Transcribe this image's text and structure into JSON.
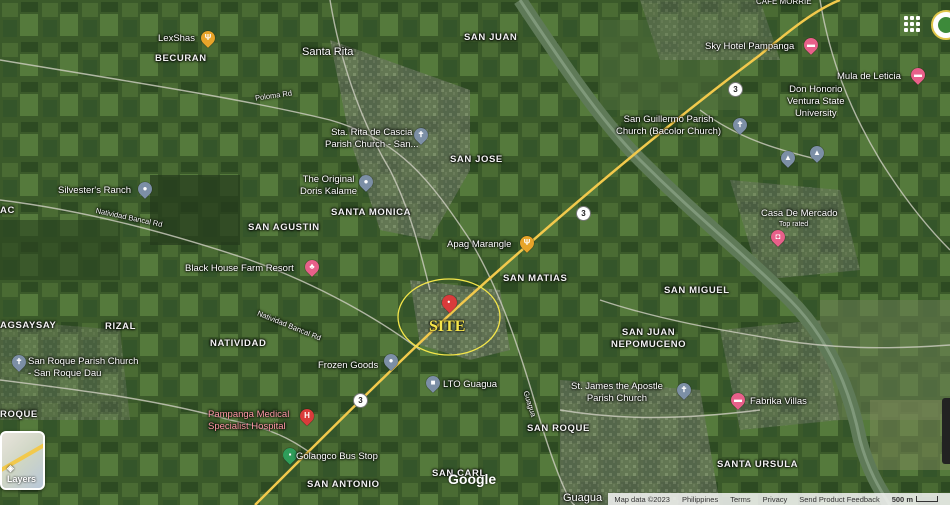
{
  "top_right_partial_label": "CAFE MORRIE",
  "areas": {
    "becuran": "BECURAN",
    "santa_rita": "Santa Rita",
    "san_juan": "SAN JUAN",
    "san_jose": "SAN JOSE",
    "santa_monica": "SANTA MONICA",
    "san_agustin": "SAN AGUSTIN",
    "san_matias": "SAN MATIAS",
    "san_miguel": "SAN MIGUEL",
    "san_juan_nepomuceno": "SAN JUAN\nNEPOMUCENO",
    "rizal": "RIZAL",
    "natividad": "NATIVIDAD",
    "agsaysay": "AGSAYSAY",
    "san_roque": "SAN ROQUE",
    "roque_left": "ROQUE",
    "santa_ursula": "SANTA URSULA",
    "san_antonio": "SAN ANTONIO",
    "san_carlos": "SAN CARL",
    "guagua": "Guagua",
    "ac_left": "AC"
  },
  "pois": {
    "lexshas": "LexShas",
    "sky_hotel": "Sky Hotel Pampanga",
    "mula_de_leticia": "Mula de Leticia",
    "san_guillermo": "San Guillermo Parish\nChurch (Bacolor Church)",
    "don_honorio": "Don Honorio\nVentura State\nUniversity",
    "sta_rita_church": "Sta. Rita de Cascia\nParish Church - San...",
    "doris_kalame": "The Original\nDoris Kalame",
    "silvesters_ranch": "Silvester's Ranch",
    "casa_de_mercado": "Casa De Mercado",
    "casa_sub": "Top rated",
    "apag_marangle": "Apag Marangle",
    "black_house": "Black House Farm Resort",
    "san_roque_parish": "San Roque Parish Church\n- San Roque Dau",
    "frozen_goods": "Frozen Goods",
    "lto_guagua": "LTO Guagua",
    "st_james": "St. James the Apostle\nParish Church",
    "fabrika_villas": "Fabrika Villas",
    "pampanga_medical": "Pampanga Medical\nSpecialist Hospital",
    "golangco": "Golangco Bus Stop"
  },
  "roads": {
    "route_number": "3",
    "road_a": "Poloma Rd",
    "road_b": "Natividad Bancal Rd",
    "road_c": "Natividad Bancal Rd",
    "road_d": "Guagua"
  },
  "annotation": {
    "site_label": "SITE",
    "circle_color": "#f4e64a"
  },
  "controls": {
    "layers_label": "Layers",
    "google_logo": "Google"
  },
  "footer": {
    "map_data": "Map data ©2023",
    "country": "Philippines",
    "terms": "Terms",
    "privacy": "Privacy",
    "feedback": "Send Product Feedback",
    "scale": "500 m"
  },
  "colors": {
    "expressway": "#f2c94c",
    "river": "#5f7a58",
    "icon_gray": "#7c8fa6",
    "icon_orange": "#e7a42a",
    "icon_pink": "#e8608a",
    "icon_red": "#d93b3b",
    "icon_green": "#2f9d5a"
  }
}
